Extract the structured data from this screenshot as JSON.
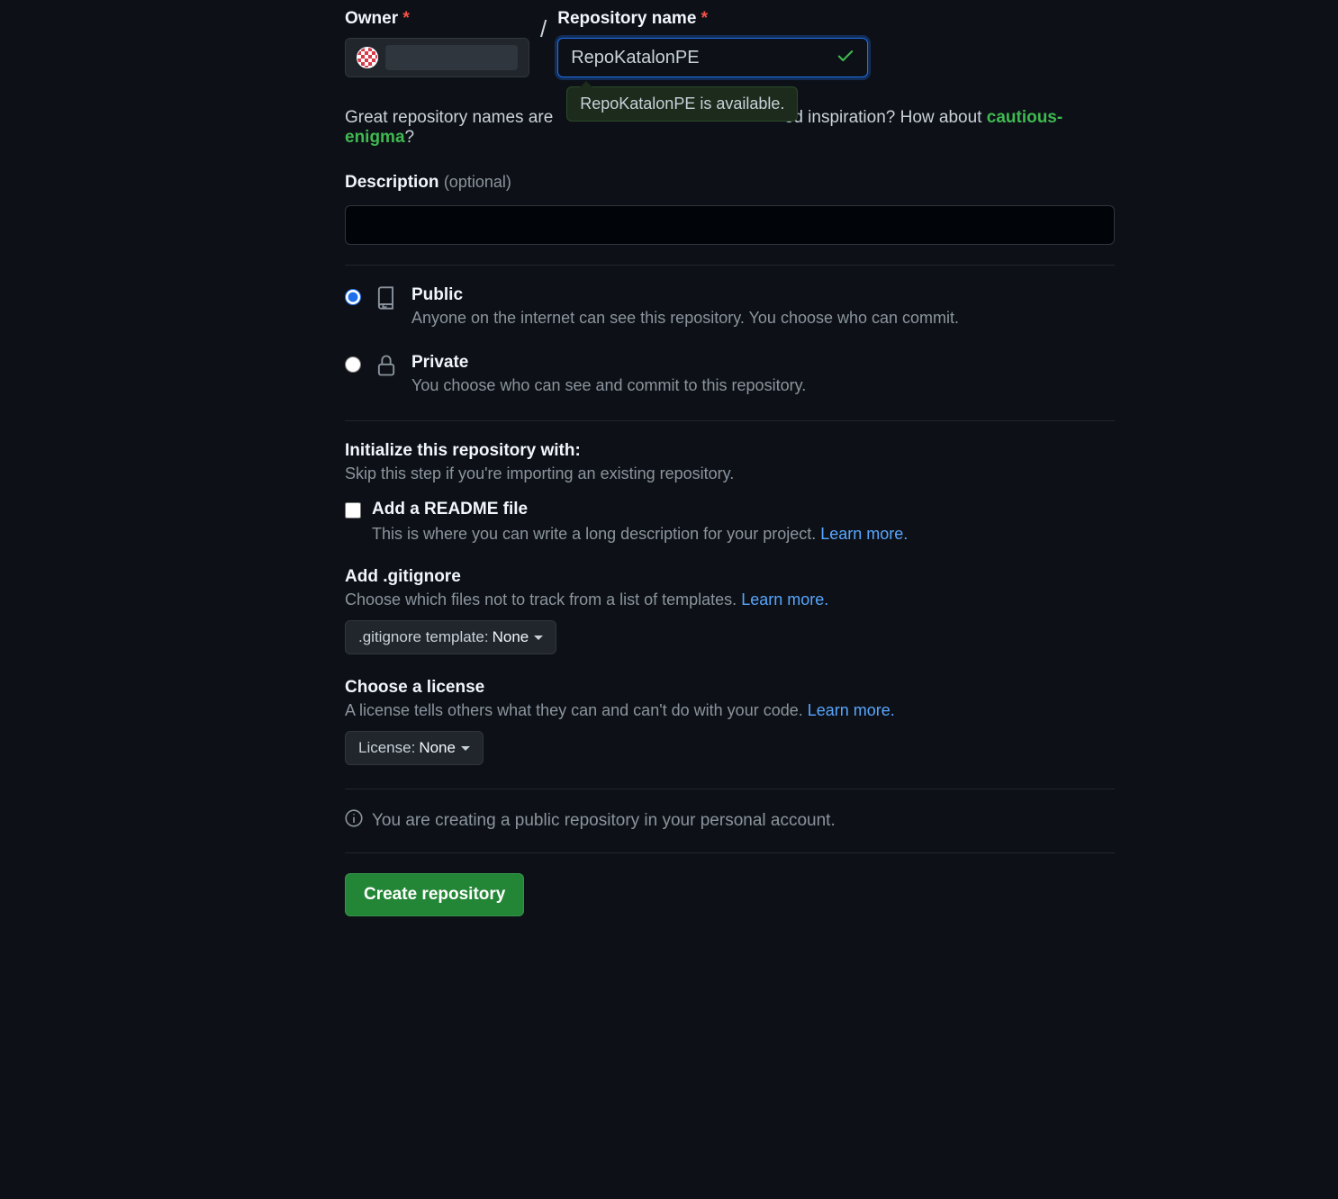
{
  "owner": {
    "label": "Owner"
  },
  "repo": {
    "label": "Repository name",
    "value": "RepoKatalonPE",
    "tooltip": "RepoKatalonPE is available."
  },
  "hint": {
    "prefix": "Great repository names are",
    "mid": "ed inspiration? How about ",
    "suggestion": "cautious-enigma",
    "suffix": "?"
  },
  "description": {
    "label": "Description",
    "optional": "(optional)",
    "value": ""
  },
  "visibility": {
    "public": {
      "title": "Public",
      "sub": "Anyone on the internet can see this repository. You choose who can commit."
    },
    "private": {
      "title": "Private",
      "sub": "You choose who can see and commit to this repository."
    }
  },
  "init": {
    "heading": "Initialize this repository with:",
    "sub": "Skip this step if you're importing an existing repository.",
    "readme": {
      "title": "Add a README file",
      "sub": "This is where you can write a long description for your project. ",
      "learn": "Learn more."
    },
    "gitignore": {
      "title": "Add .gitignore",
      "sub": "Choose which files not to track from a list of templates. ",
      "learn": "Learn more.",
      "btn_prefix": ".gitignore template:",
      "btn_value": "None"
    },
    "license": {
      "title": "Choose a license",
      "sub": "A license tells others what they can and can't do with your code. ",
      "learn": "Learn more.",
      "btn_prefix": "License:",
      "btn_value": "None"
    }
  },
  "info": "You are creating a public repository in your personal account.",
  "submit": "Create repository"
}
